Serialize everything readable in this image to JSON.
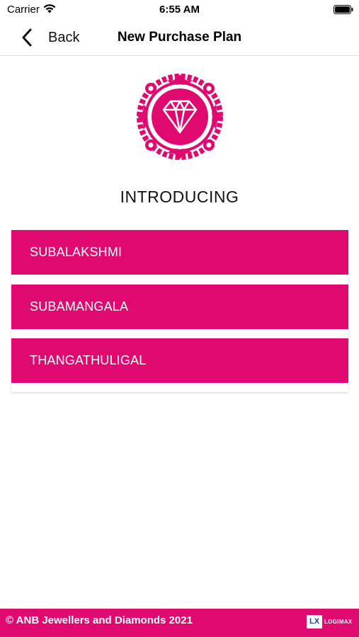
{
  "status_bar": {
    "carrier": "Carrier",
    "time": "6:55 AM"
  },
  "nav": {
    "back_label": "Back",
    "title": "New Purchase Plan"
  },
  "intro": {
    "heading": "INTRODUCING"
  },
  "plans": [
    {
      "label": "SUBALAKSHMI"
    },
    {
      "label": "SUBAMANGALA"
    },
    {
      "label": "THANGATHULIGAL"
    }
  ],
  "footer": {
    "copyright": "© ANB Jewellers and Diamonds 2021",
    "brand_badge": "LX",
    "brand_name": "LOGIMAX"
  },
  "colors": {
    "brand": "#e0096f",
    "nav_text": "#111111"
  },
  "icons": [
    "wifi-icon",
    "battery-icon",
    "chevron-left-icon",
    "diamond-logo-icon"
  ]
}
